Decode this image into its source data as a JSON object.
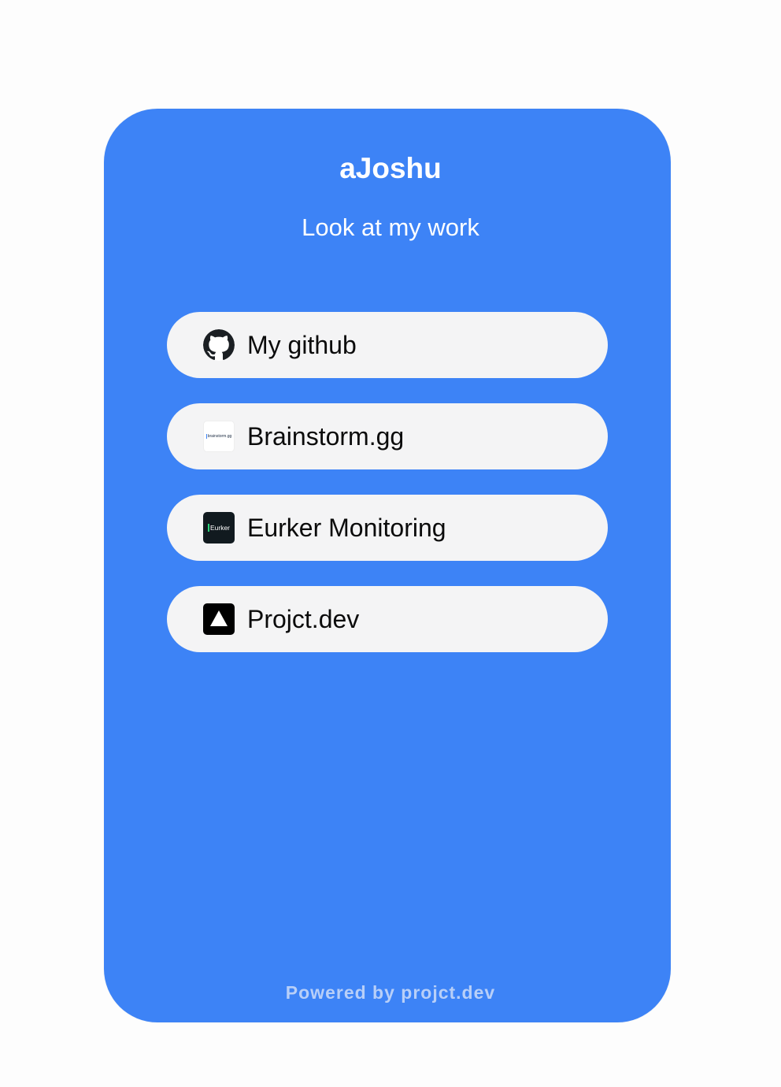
{
  "profile": {
    "name": "aJoshu",
    "tagline": "Look at my work"
  },
  "links": [
    {
      "label": "My github",
      "icon": "github-icon"
    },
    {
      "label": "Brainstorm.gg",
      "icon": "brainstorm-logo-icon",
      "icon_text": "brainstorm.gg"
    },
    {
      "label": "Eurker Monitoring",
      "icon": "eurker-logo-icon",
      "icon_text": "Eurker"
    },
    {
      "label": "Projct.dev",
      "icon": "projct-triangle-icon"
    }
  ],
  "footer": {
    "text": "Powered by projct.dev"
  },
  "colors": {
    "card_background": "#3d83f6",
    "link_background": "#f4f4f5",
    "text_on_card": "#ffffff",
    "footer_text": "#b8cff8"
  }
}
